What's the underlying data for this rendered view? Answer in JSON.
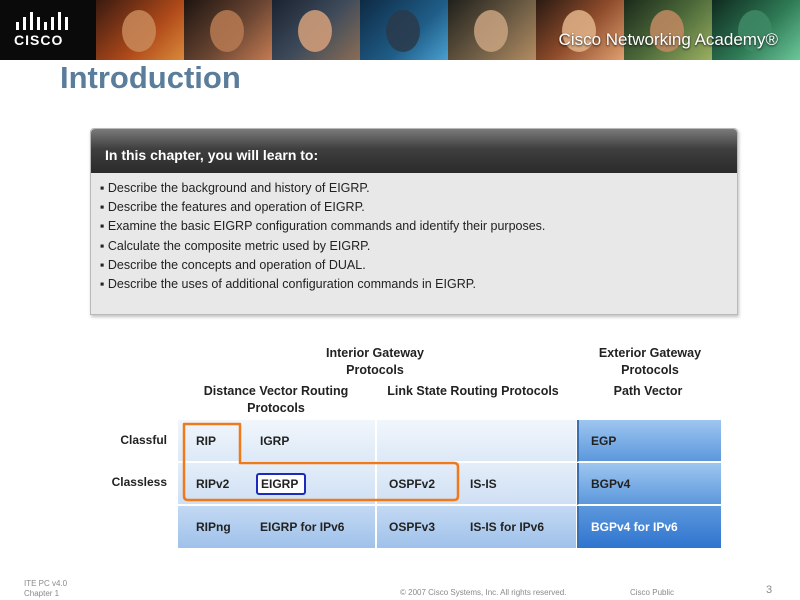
{
  "header": {
    "logo_text": "CISCO",
    "academy_text": "Cisco Networking Academy®"
  },
  "title": "Introduction",
  "objectives": {
    "heading": "In this chapter, you will learn to:",
    "items": [
      "▪ Describe the background and history of EIGRP.",
      "▪ Describe the features and operation of EIGRP.",
      "▪ Examine the basic EIGRP configuration commands and identify their purposes.",
      "▪ Calculate the composite metric used by EIGRP.",
      "▪ Describe the concepts and operation of DUAL.",
      "▪ Describe the uses of additional configuration commands in EIGRP."
    ]
  },
  "diagram": {
    "igp_header": "Interior Gateway Protocols",
    "egp_header": "Exterior Gateway Protocols",
    "dv_header": "Distance Vector Routing Protocols",
    "ls_header": "Link State Routing Protocols",
    "pv_header": "Path Vector",
    "row_labels": [
      "Classful",
      "Classless"
    ],
    "rows": [
      {
        "dv1": "RIP",
        "dv2": "IGRP",
        "ls1": "",
        "ls2": "",
        "egp": "EGP"
      },
      {
        "dv1": "RIPv2",
        "dv2": "EIGRP",
        "ls1": "OSPFv2",
        "ls2": "IS-IS",
        "egp": "BGPv4"
      },
      {
        "dv1": "RIPng",
        "dv2": "EIGRP for IPv6",
        "ls1": "OSPFv3",
        "ls2": "IS-IS for IPv6",
        "egp": "BGPv4 for IPv6"
      }
    ],
    "colors": {
      "light_cell": "#e6eff9",
      "mid_cell": "#c7daf2",
      "dark_cell": "#9cbde6",
      "egp_cell": "#5f9be0",
      "highlight_orange": "#f07a1a",
      "highlight_blue": "#1b2bbd"
    }
  },
  "footer": {
    "course": "ITE PC v4.0",
    "chapter": "Chapter 1",
    "copyright": "© 2007 Cisco Systems, Inc. All rights reserved.",
    "classification": "Cisco Public",
    "page_number": "3"
  }
}
